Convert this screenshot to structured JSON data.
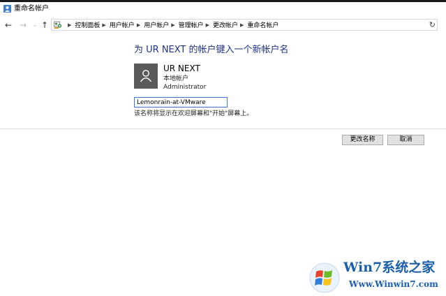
{
  "window": {
    "title": "重命名帐户",
    "icon": "user-accounts-icon"
  },
  "navigation": {
    "back_icon": "back-arrow-icon",
    "forward_icon": "forward-arrow-icon",
    "recent_icon": "chevron-down-icon",
    "up_icon": "up-arrow-icon",
    "address_icon": "control-panel-icon",
    "breadcrumbs": [
      "控制面板",
      "用户帐户",
      "用户帐户",
      "管理帐户",
      "更改帐户",
      "重命名帐户"
    ],
    "refresh_icon": "refresh-icon"
  },
  "main": {
    "heading": "为 UR NEXT 的帐户键入一个新帐户名",
    "account": {
      "avatar_icon": "user-avatar-icon",
      "name": "UR NEXT",
      "type": "本地帐户",
      "role": "Administrator"
    },
    "new_name_input": {
      "value": "Lemonrain-at-VMware"
    },
    "hint": "该名称将显示在欢迎屏幕和\"开始\"屏幕上。"
  },
  "actions": {
    "rename_label": "更改名称",
    "cancel_label": "取消"
  },
  "watermark": {
    "title": "Win7系统之家",
    "url": "Www.Winwin7.com"
  },
  "colors": {
    "heading": "#1e3287",
    "avatar_bg": "#5a5a5a",
    "input_border": "#3a78d4",
    "watermark": "#1b5faa"
  }
}
